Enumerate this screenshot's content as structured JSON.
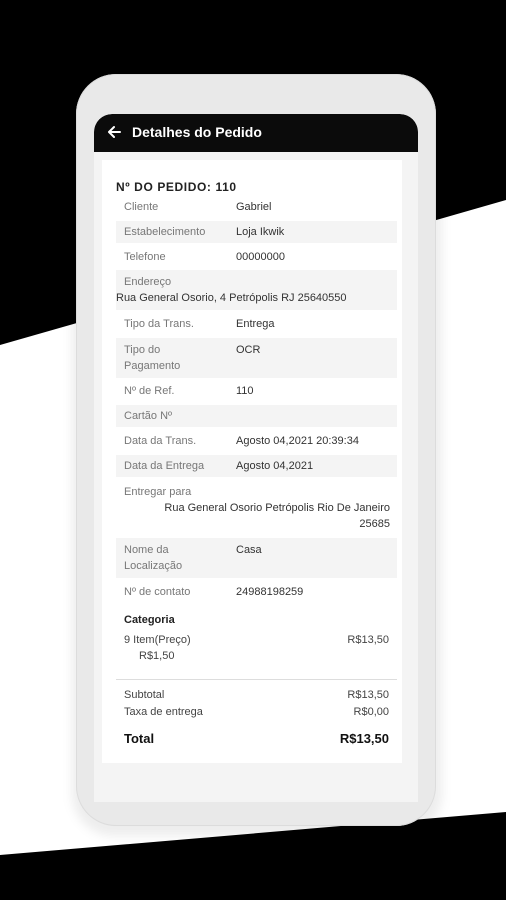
{
  "appbar": {
    "title": "Detalhes do Pedido"
  },
  "order": {
    "title": "Nº DO PEDIDO: 110",
    "fields": [
      {
        "label": "Cliente",
        "value": "Gabriel"
      },
      {
        "label": "Estabelecimento",
        "value": "Loja Ikwik"
      },
      {
        "label": "Telefone",
        "value": "00000000"
      },
      {
        "label": "Endereço",
        "value": "Rua General Osorio, 4 Petrópolis RJ 25640550"
      },
      {
        "label": "Tipo da Trans.",
        "value": "Entrega"
      },
      {
        "label_line1": "Tipo do",
        "label_line2": "Pagamento",
        "value": "OCR"
      },
      {
        "label": "Nº de Ref.",
        "value": "110"
      },
      {
        "label": "Cartão Nº",
        "value": ""
      },
      {
        "label": "Data da Trans.",
        "value": "Agosto 04,2021 20:39:34"
      },
      {
        "label": "Data da Entrega",
        "value": "Agosto 04,2021"
      },
      {
        "label": "Entregar para",
        "value_line1": "Rua General Osorio Petrópolis Rio De Janeiro",
        "value_line2": "25685"
      },
      {
        "label_line1": "Nome da",
        "label_line2": "Localização",
        "value": "Casa"
      },
      {
        "label": "Nº de contato",
        "value": "24988198259"
      }
    ]
  },
  "category": {
    "title": "Categoria",
    "item_line1": "9  Item(Preço)",
    "item_line2": "R$1,50",
    "item_total": "R$13,50"
  },
  "summary": {
    "subtotal_label": "Subtotal",
    "subtotal_value": "R$13,50",
    "delivery_label": "Taxa de entrega",
    "delivery_value": "R$0,00",
    "total_label": "Total",
    "total_value": "R$13,50"
  }
}
